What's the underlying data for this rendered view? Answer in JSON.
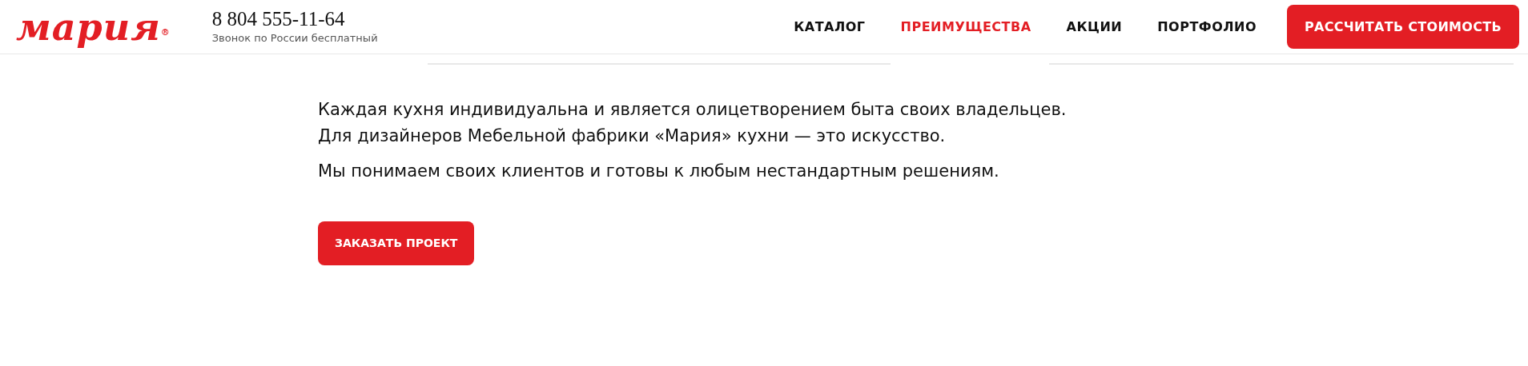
{
  "header": {
    "logo": {
      "text": "мария",
      "mark": "®"
    },
    "phone": "8 804 555-11-64",
    "phone_note": "Звонок по России бесплатный",
    "nav": [
      {
        "label": "КАТАЛОГ",
        "selected": false
      },
      {
        "label": "ПРЕИМУЩЕСТВА",
        "selected": true
      },
      {
        "label": "АКЦИИ",
        "selected": false
      },
      {
        "label": "ПОРТФОЛИО",
        "selected": false
      }
    ],
    "cta": "РАССЧИТАТЬ СТОИМОСТЬ"
  },
  "content": {
    "paragraphs": [
      "Каждая кухня индивидуальна и является олицетворением быта своих владельцев.\nДля дизайнеров Мебельной фабрики «Мария» кухни — это искусство.",
      "Мы понимаем своих клиентов и готовы к любым нестандартным решениям."
    ],
    "button": "ЗАКАЗАТЬ ПРОЕКТ"
  }
}
